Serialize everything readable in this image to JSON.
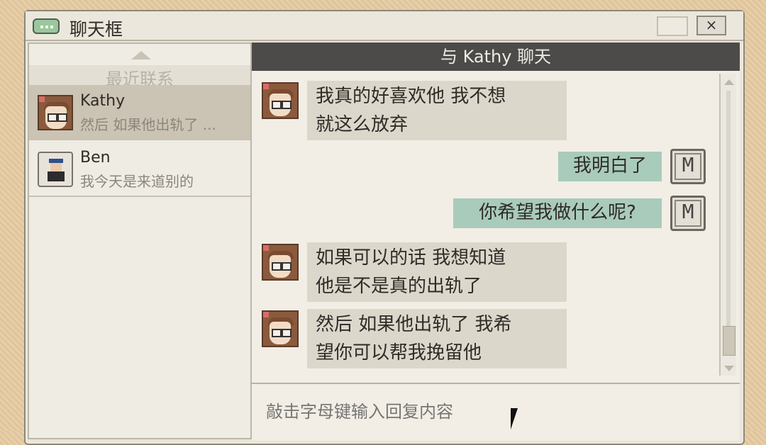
{
  "window": {
    "title": "聊天框",
    "close_label": "×"
  },
  "contacts": {
    "header": "最近联系",
    "items": [
      {
        "name": "Kathy",
        "preview": "然后 如果他出轨了 ...",
        "active": true
      },
      {
        "name": "Ben",
        "preview": "我今天是来道别的",
        "active": false
      }
    ]
  },
  "chat": {
    "header": "与 Kathy 聊天",
    "messages": [
      {
        "from": "Kathy",
        "lines": [
          "我真的好喜欢他 我不想",
          "就这么放弃"
        ]
      },
      {
        "from": "me",
        "avatar": "M",
        "text": "我明白了"
      },
      {
        "from": "me",
        "avatar": "M",
        "text": "你希望我做什么呢?"
      },
      {
        "from": "Kathy",
        "lines": [
          "如果可以的话 我想知道",
          "他是不是真的出轨了"
        ]
      },
      {
        "from": "Kathy",
        "lines": [
          "然后 如果他出轨了 我希",
          "望你可以帮我挽留他"
        ]
      }
    ]
  },
  "input": {
    "placeholder": "敲击字母键输入回复内容"
  },
  "colors": {
    "accent": "#a9cbbc",
    "header": "#4c4b49",
    "incoming": "#dcd7cb"
  }
}
